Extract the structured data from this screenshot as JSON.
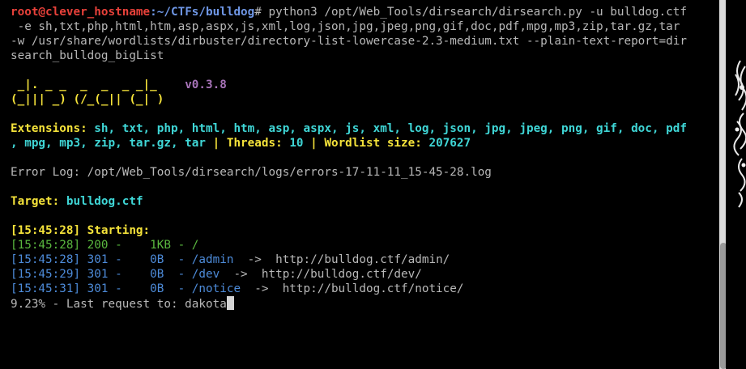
{
  "prompt": {
    "user_host": "root@clever_hostname",
    "path": ":~/CTFs/bulldog",
    "symbol": "# ",
    "command_lines": [
      "python3 /opt/Web_Tools/dirsearch/dirsearch.py -u bulldog.ctf",
      " -e sh,txt,php,html,htm,asp,aspx,js,xml,log,json,jpg,jpeg,png,gif,doc,pdf,mpg,mp3,zip,tar.gz,tar",
      "-w /usr/share/wordlists/dirbuster/directory-list-lowercase-2.3-medium.txt --plain-text-report=dir",
      "search_bulldog_bigList"
    ]
  },
  "banner": {
    "art_line1": " _|. _ _  _  _  _ _|_    ",
    "version": "v0.3.8",
    "art_line2": "(_||| _) (/_(_|| (_| )"
  },
  "config": {
    "extensions_label": "Extensions: ",
    "extensions_line1": "sh, txt, php, html, htm, asp, aspx, js, xml, log, json, jpg, jpeg, png, gif, doc, pdf",
    "extensions_line2": ", mpg, mp3, zip, tar.gz, tar",
    "sep1": " | ",
    "threads_label": "Threads: ",
    "threads_value": "10",
    "sep2": " | ",
    "wordlist_label": "Wordlist size: ",
    "wordlist_value": "207627"
  },
  "error_log": "Error Log: /opt/Web_Tools/dirsearch/logs/errors-17-11-11_15-45-28.log",
  "target": {
    "label": "Target: ",
    "value": "bulldog.ctf"
  },
  "starting": "[15:45:28] Starting:",
  "results": [
    {
      "text": "[15:45:28] 200 -    1KB - /",
      "redirect": ""
    },
    {
      "text": "[15:45:28] 301 -    0B  - /admin",
      "redirect": "  ->  http://bulldog.ctf/admin/"
    },
    {
      "text": "[15:45:29] 301 -    0B  - /dev",
      "redirect": "  ->  http://bulldog.ctf/dev/"
    },
    {
      "text": "[15:45:31] 301 -    0B  - /notice",
      "redirect": "  ->  http://bulldog.ctf/notice/"
    }
  ],
  "progress": "9.23% - Last request to: dakota",
  "colors": {
    "background": "#000000",
    "prompt_user": "#e8413a",
    "prompt_path": "#6f97e6",
    "label_yellow": "#f4e23a",
    "value_cyan": "#3fd6d6",
    "status_200": "#5ab83f",
    "status_301": "#4d8bd9",
    "banner_purple": "#a773b8"
  }
}
